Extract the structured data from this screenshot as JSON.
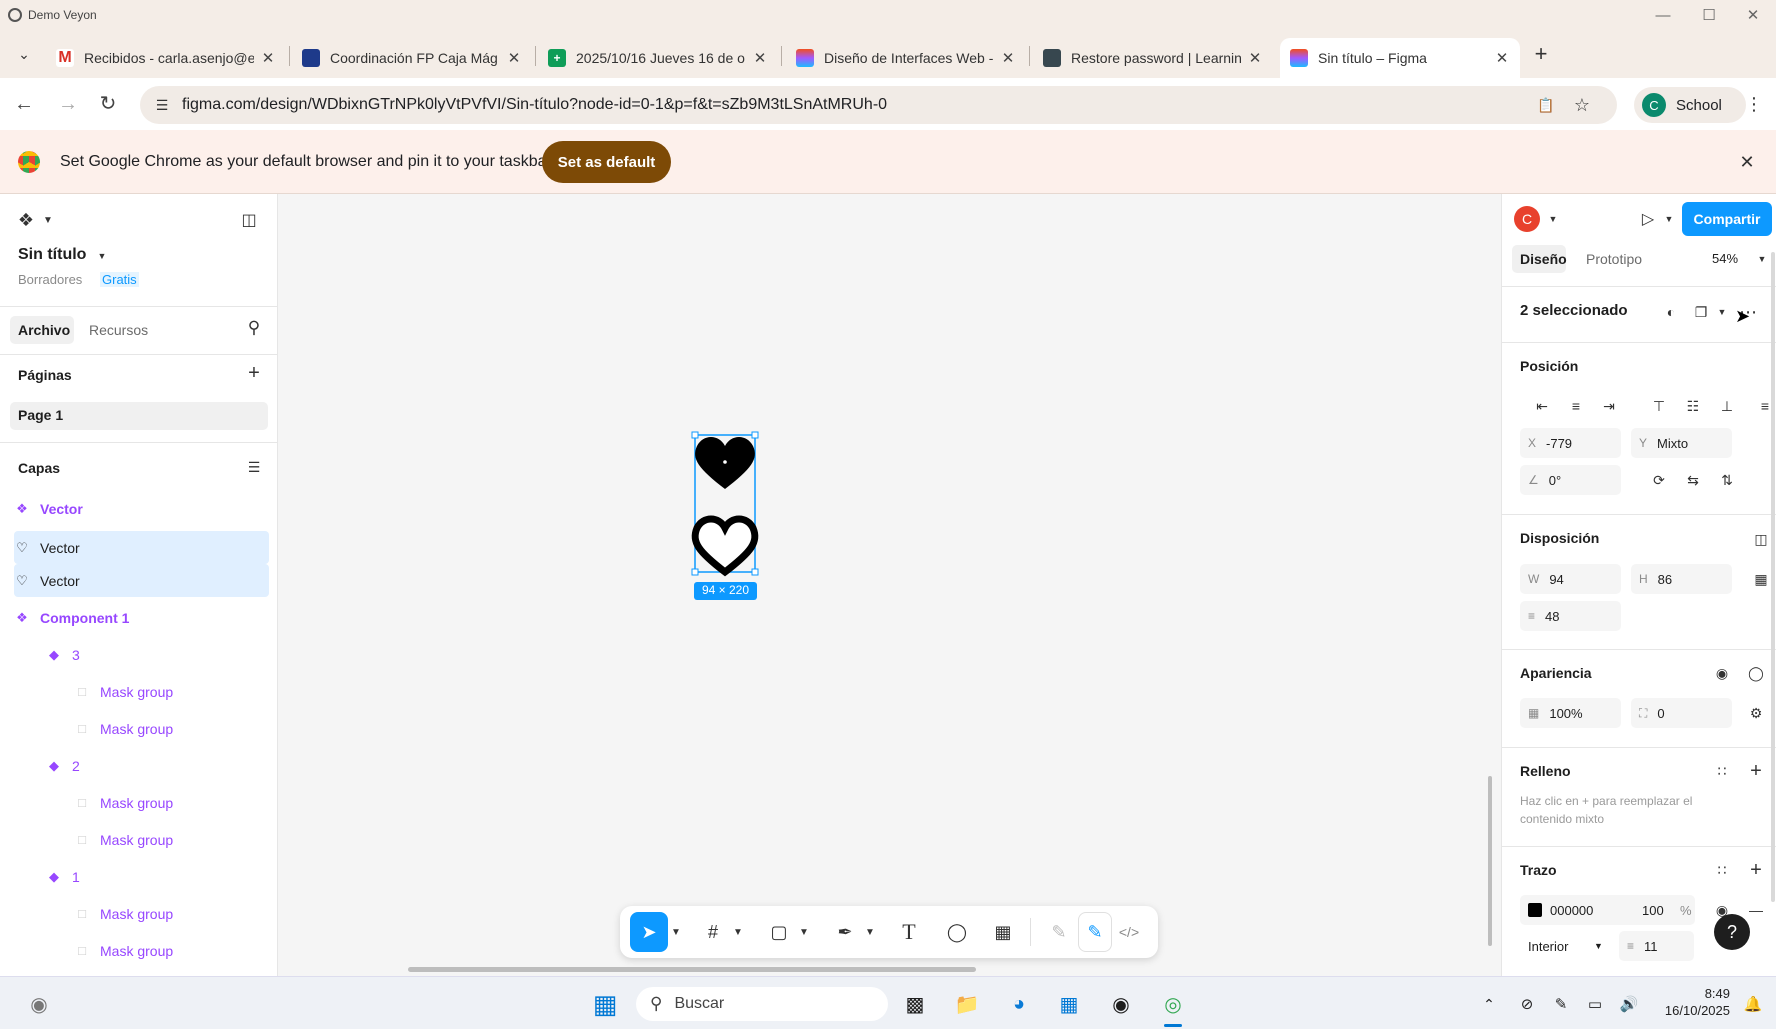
{
  "window": {
    "title": "Demo Veyon"
  },
  "tabs": [
    {
      "label": "Recibidos - carla.asenjo@e",
      "icon": "gmail-icon",
      "color": "#d93025"
    },
    {
      "label": "Coordinación FP Caja Mág",
      "icon": "classroom-icon",
      "color": "#1e3a8a"
    },
    {
      "label": "2025/10/16 Jueves 16 de o",
      "icon": "sheets-icon",
      "color": "#0f9d58"
    },
    {
      "label": "Diseño de Interfaces Web -",
      "icon": "figma-icon",
      "color": "#a259ff"
    },
    {
      "label": "Restore password | Learnin",
      "icon": "learning-icon",
      "color": "#37474f"
    },
    {
      "label": "Sin título – Figma",
      "icon": "figma-icon",
      "color": "#a259ff"
    }
  ],
  "browser": {
    "url": "figma.com/design/WDbixnGTrNPk0lyVtPVfVI/Sin-título?node-id=0-1&p=f&t=sZb9M3tLSnAtMRUh-0",
    "profile_initial": "C",
    "profile_label": "School"
  },
  "infobar": {
    "message": "Set Google Chrome as your default browser and pin it to your taskbar",
    "button": "Set as default"
  },
  "left_panel": {
    "file_name": "Sin título",
    "location": "Borradores",
    "plan": "Gratis",
    "tabs": [
      "Archivo",
      "Recursos"
    ],
    "pages_title": "Páginas",
    "page": "Page 1",
    "layers_title": "Capas",
    "layers": [
      {
        "name": "Vector",
        "icon": "component-icon",
        "type": "component",
        "selected": false
      },
      {
        "name": "Vector",
        "icon": "heart-icon",
        "type": "vector",
        "selected": true
      },
      {
        "name": "Vector",
        "icon": "heart-icon",
        "type": "vector",
        "selected": true
      },
      {
        "name": "Component 1",
        "icon": "component-icon",
        "type": "component",
        "selected": false
      },
      {
        "name": "3",
        "icon": "instance-icon",
        "type": "instance",
        "selected": false
      },
      {
        "name": "Mask group",
        "icon": "mask-icon",
        "type": "mask",
        "selected": false
      },
      {
        "name": "Mask group",
        "icon": "mask-icon",
        "type": "mask",
        "selected": false
      },
      {
        "name": "2",
        "icon": "instance-icon",
        "type": "instance",
        "selected": false
      },
      {
        "name": "Mask group",
        "icon": "mask-icon",
        "type": "mask",
        "selected": false
      },
      {
        "name": "Mask group",
        "icon": "mask-icon",
        "type": "mask",
        "selected": false
      },
      {
        "name": "1",
        "icon": "instance-icon",
        "type": "instance",
        "selected": false
      },
      {
        "name": "Mask group",
        "icon": "mask-icon",
        "type": "mask",
        "selected": false
      },
      {
        "name": "Mask group",
        "icon": "mask-icon",
        "type": "mask",
        "selected": false
      }
    ]
  },
  "canvas": {
    "selection_size": "94 × 220"
  },
  "right_panel": {
    "avatar_initial": "C",
    "share_button": "Compartir",
    "tabs": [
      "Diseño",
      "Prototipo"
    ],
    "zoom": "54%",
    "selection_title": "2 seleccionado",
    "position": {
      "title": "Posición",
      "x_label": "X",
      "x": "-779",
      "y_label": "Y",
      "y": "Mixto",
      "rotation": "0°"
    },
    "layout": {
      "title": "Disposición",
      "w_label": "W",
      "w": "94",
      "h_label": "H",
      "h": "86",
      "gap": "48"
    },
    "appearance": {
      "title": "Apariencia",
      "opacity": "100%",
      "radius": "0"
    },
    "fill": {
      "title": "Relleno",
      "hint": "Haz clic en + para reemplazar el contenido mixto"
    },
    "stroke": {
      "title": "Trazo",
      "color_hex": "000000",
      "opacity": "100",
      "percent": "%",
      "align": "Interior",
      "weight": "11"
    }
  },
  "taskbar": {
    "search_placeholder": "Buscar",
    "time": "8:49",
    "date": "16/10/2025"
  }
}
